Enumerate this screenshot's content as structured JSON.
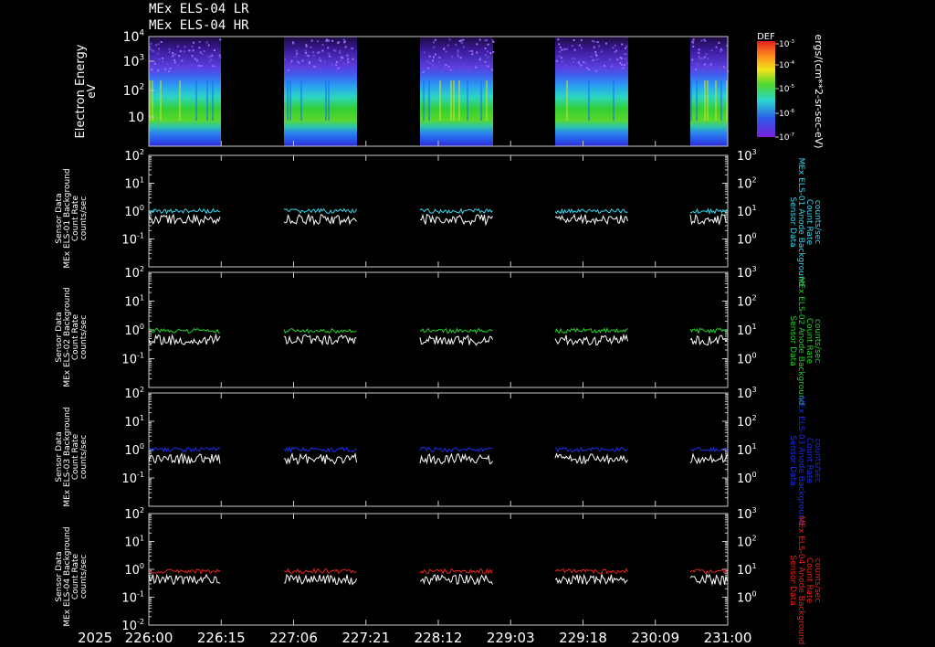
{
  "title": {
    "line1": "MEx ELS-04 LR",
    "line2": "MEx ELS-04 HR"
  },
  "colors": {
    "cyan": "#36d6ee",
    "green": "#22d12a",
    "blue": "#1c2ee8",
    "red": "#e5221c",
    "white": "#ffffff",
    "axis": "#c8c8c8"
  },
  "spectrogram": {
    "ylabel": "Electron Energy",
    "yunit": "eV",
    "yticks": [
      {
        "base": "10",
        "exp": "4"
      },
      {
        "base": "10",
        "exp": "3"
      },
      {
        "base": "10",
        "exp": "2"
      },
      {
        "base": "10",
        "exp": ""
      }
    ],
    "colorbar": {
      "label": "DEF",
      "unit": "ergs/(cm**2-sr-sec-eV)",
      "ticks": [
        {
          "base": "10",
          "exp": "-3"
        },
        {
          "base": "10",
          "exp": "-4"
        },
        {
          "base": "10",
          "exp": "-5"
        },
        {
          "base": "10",
          "exp": "-6"
        },
        {
          "base": "10",
          "exp": "-7"
        }
      ]
    }
  },
  "panels": [
    {
      "left_label": [
        "Sensor Data",
        "MEx ELS-01 Background",
        "Count Rate",
        "counts/sec"
      ],
      "right_label": [
        "MEx ELS-01 Anode Background",
        "Sensor Data",
        "Count Rate",
        "counts/sec"
      ],
      "color": "#36d6ee",
      "left_ticks": [
        {
          "b": "10",
          "e": "2"
        },
        {
          "b": "10",
          "e": "1"
        },
        {
          "b": "10",
          "e": "0"
        },
        {
          "b": "10",
          "e": "-1"
        }
      ],
      "right_ticks": [
        {
          "b": "10",
          "e": "3"
        },
        {
          "b": "10",
          "e": "2"
        },
        {
          "b": "10",
          "e": "1"
        },
        {
          "b": "10",
          "e": "0"
        }
      ]
    },
    {
      "left_label": [
        "Sensor Data",
        "MEx ELS-02 Background",
        "Count Rate",
        "counts/sec"
      ],
      "right_label": [
        "MEx ELS-02 Anode Background",
        "Sensor Data",
        "Count Rate",
        "counts/sec"
      ],
      "color": "#22d12a",
      "left_ticks": [
        {
          "b": "10",
          "e": "2"
        },
        {
          "b": "10",
          "e": "1"
        },
        {
          "b": "10",
          "e": "0"
        },
        {
          "b": "10",
          "e": "-1"
        }
      ],
      "right_ticks": [
        {
          "b": "10",
          "e": "3"
        },
        {
          "b": "10",
          "e": "2"
        },
        {
          "b": "10",
          "e": "1"
        },
        {
          "b": "10",
          "e": "0"
        }
      ]
    },
    {
      "left_label": [
        "Sensor Data",
        "MEx ELS-03 Background",
        "Count Rate",
        "counts/sec"
      ],
      "right_label": [
        "MEx ELS-03 Anode Background",
        "Sensor Data",
        "Count Rate",
        "counts/sec"
      ],
      "color": "#1c2ee8",
      "left_ticks": [
        {
          "b": "10",
          "e": "2"
        },
        {
          "b": "10",
          "e": "1"
        },
        {
          "b": "10",
          "e": "0"
        },
        {
          "b": "10",
          "e": "-1"
        }
      ],
      "right_ticks": [
        {
          "b": "10",
          "e": "3"
        },
        {
          "b": "10",
          "e": "2"
        },
        {
          "b": "10",
          "e": "1"
        },
        {
          "b": "10",
          "e": "0"
        }
      ]
    },
    {
      "left_label": [
        "Sensor Data",
        "MEx ELS-04 Background",
        "Count Rate",
        "counts/sec"
      ],
      "right_label": [
        "MEx ELS-04 Anode Background",
        "Sensor Data",
        "Count Rate",
        "counts/sec"
      ],
      "color": "#e5221c",
      "left_ticks": [
        {
          "b": "10",
          "e": "2"
        },
        {
          "b": "10",
          "e": "1"
        },
        {
          "b": "10",
          "e": "0"
        },
        {
          "b": "10",
          "e": "-1"
        },
        {
          "b": "10",
          "e": "-2"
        }
      ],
      "right_ticks": [
        {
          "b": "10",
          "e": "3"
        },
        {
          "b": "10",
          "e": "2"
        },
        {
          "b": "10",
          "e": "1"
        },
        {
          "b": "10",
          "e": "0"
        }
      ]
    }
  ],
  "xaxis": {
    "year": "2025",
    "ticks": [
      "226:00",
      "226:15",
      "227:06",
      "227:21",
      "228:12",
      "229:03",
      "229:18",
      "230:09",
      "231:00"
    ]
  },
  "chart_data": {
    "type": "line",
    "x_range": [
      "226:00",
      "231:00"
    ],
    "data_segments": [
      [
        "226:00",
        "226:15"
      ],
      [
        "227:06",
        "227:21"
      ],
      [
        "228:12",
        "228:27"
      ],
      [
        "229:06",
        "229:21"
      ],
      [
        "230:15",
        "231:00"
      ]
    ],
    "series": [
      {
        "values_cyan_upper": 1.0,
        "values_white_lower": 0.6
      },
      {
        "values_green_upper": 0.9,
        "values_white_lower": 0.5
      },
      {
        "values_blue_upper": 1.0,
        "values_white_lower": 0.6
      },
      {
        "values_red_upper": 1.0,
        "values_white_lower": 0.6
      }
    ],
    "ylim_left": [
      0.1,
      100
    ],
    "ylim_right": [
      1,
      1000
    ]
  }
}
